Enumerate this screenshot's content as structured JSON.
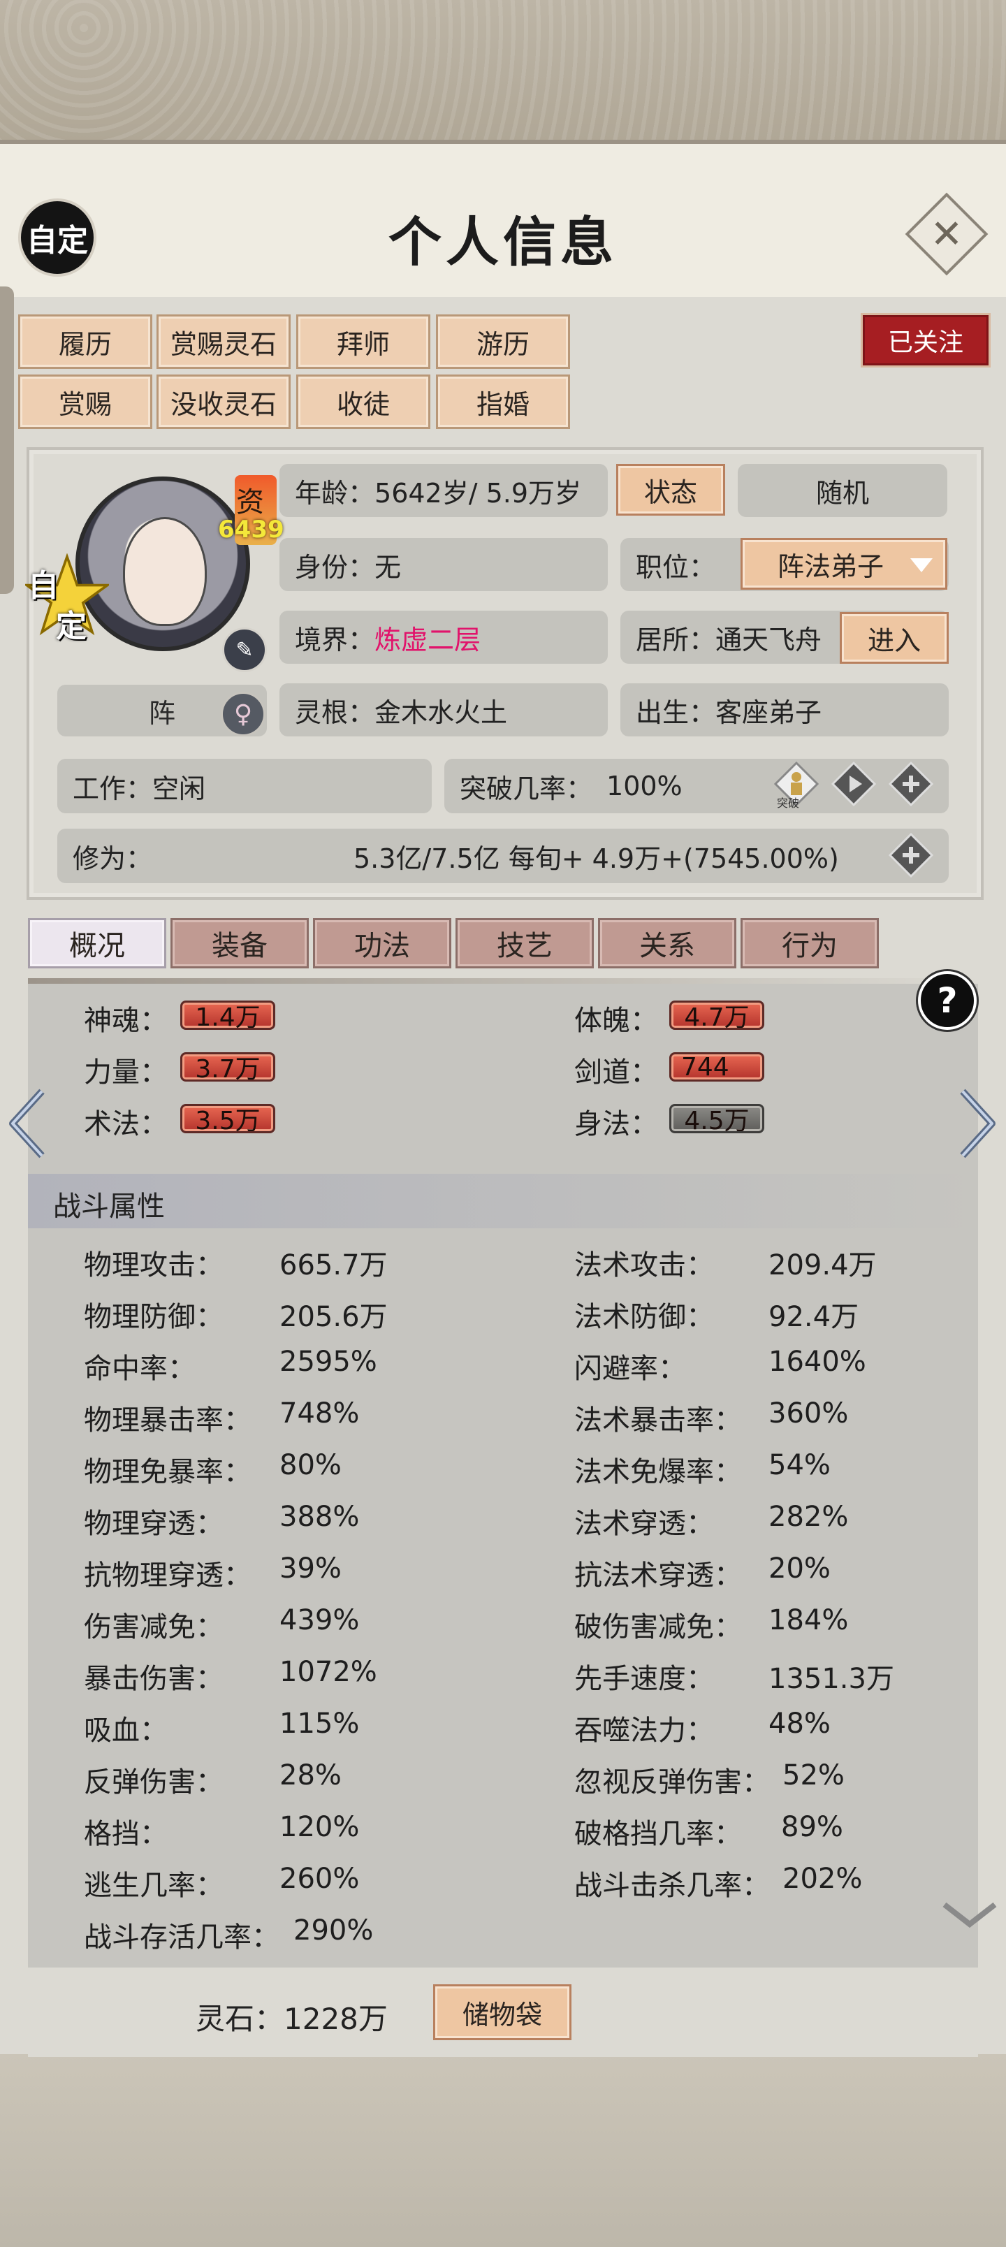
{
  "header": {
    "auto_label": "自定",
    "title": "个人信息",
    "close_icon": "close-icon"
  },
  "actions": {
    "row1": [
      "履历",
      "赏赐灵石",
      "拜师",
      "游历"
    ],
    "row2": [
      "赏赐",
      "没收灵石",
      "收徒",
      "指婚"
    ],
    "follow": "已关注"
  },
  "profile": {
    "talent_label": "资",
    "talent_value": "6439",
    "star_text_1": "自",
    "star_text_2": "定",
    "formation_label": "阵",
    "age_label": "年龄：",
    "age_value": "5642岁/ 5.9万岁",
    "status_btn": "状态",
    "random_btn": "随机",
    "identity_label": "身份：",
    "identity_value": "无",
    "position_label": "职位：",
    "position_value": "阵法弟子",
    "realm_label": "境界：",
    "realm_value": "炼虚二层",
    "residence_label": "居所：",
    "residence_value": "通天飞舟",
    "enter_btn": "进入",
    "root_label": "灵根：",
    "root_value": "金木水火土",
    "origin_label": "出生：",
    "origin_value": "客座弟子",
    "work_label": "工作：",
    "work_value": "空闲",
    "breakthrough_label": "突破几率：",
    "breakthrough_value": "100%",
    "breakthrough_icon_label": "突破",
    "cultivation_label": "修为：",
    "cultivation_value": "5.3亿/7.5亿  每旬+  4.9万+(7545.00%)"
  },
  "tabs": [
    "概况",
    "装备",
    "功法",
    "技艺",
    "关系",
    "行为"
  ],
  "active_tab": 0,
  "attributes": [
    {
      "label": "神魂：",
      "value": "1.4万",
      "style": "red"
    },
    {
      "label": "体魄：",
      "value": "4.7万",
      "style": "red"
    },
    {
      "label": "力量：",
      "value": "3.7万",
      "style": "red"
    },
    {
      "label": "剑道：",
      "value": "744",
      "style": "red"
    },
    {
      "label": "术法：",
      "value": "3.5万",
      "style": "red"
    },
    {
      "label": "身法：",
      "value": "4.5万",
      "style": "gray"
    }
  ],
  "combat": {
    "title": "战斗属性",
    "left": [
      {
        "label": "物理攻击：",
        "value": "665.7万"
      },
      {
        "label": "物理防御：",
        "value": "205.6万"
      },
      {
        "label": "命中率：",
        "value": "2595%"
      },
      {
        "label": "物理暴击率：",
        "value": "748%"
      },
      {
        "label": "物理免暴率：",
        "value": "80%"
      },
      {
        "label": "物理穿透：",
        "value": "388%"
      },
      {
        "label": "抗物理穿透：",
        "value": "39%"
      },
      {
        "label": "伤害减免：",
        "value": "439%"
      },
      {
        "label": "暴击伤害：",
        "value": "1072%"
      },
      {
        "label": "吸血：",
        "value": "115%"
      },
      {
        "label": "反弹伤害：",
        "value": "28%"
      },
      {
        "label": "格挡：",
        "value": "120%"
      },
      {
        "label": "逃生几率：",
        "value": "260%"
      },
      {
        "label": "战斗存活几率：",
        "value": "290%"
      }
    ],
    "right": [
      {
        "label": "法术攻击：",
        "value": "209.4万"
      },
      {
        "label": "法术防御：",
        "value": "92.4万"
      },
      {
        "label": "闪避率：",
        "value": "1640%"
      },
      {
        "label": "法术暴击率：",
        "value": "360%"
      },
      {
        "label": "法术免爆率：",
        "value": "54%"
      },
      {
        "label": "法术穿透：",
        "value": "282%"
      },
      {
        "label": "抗法术穿透：",
        "value": "20%"
      },
      {
        "label": "破伤害减免：",
        "value": "184%"
      },
      {
        "label": "先手速度：",
        "value": "1351.3万"
      },
      {
        "label": "吞噬法力：",
        "value": "48%"
      },
      {
        "label": "忽视反弹伤害：",
        "value": "52%"
      },
      {
        "label": "破格挡几率：",
        "value": "89%"
      },
      {
        "label": "战斗击杀几率：",
        "value": "202%"
      }
    ]
  },
  "footer": {
    "stone_label": "灵石：1228万",
    "bag_btn": "储物袋"
  },
  "colors": {
    "accent_red": "#a61e22",
    "realm_pink": "#e1136b",
    "button_tan": "#eec6a2"
  }
}
